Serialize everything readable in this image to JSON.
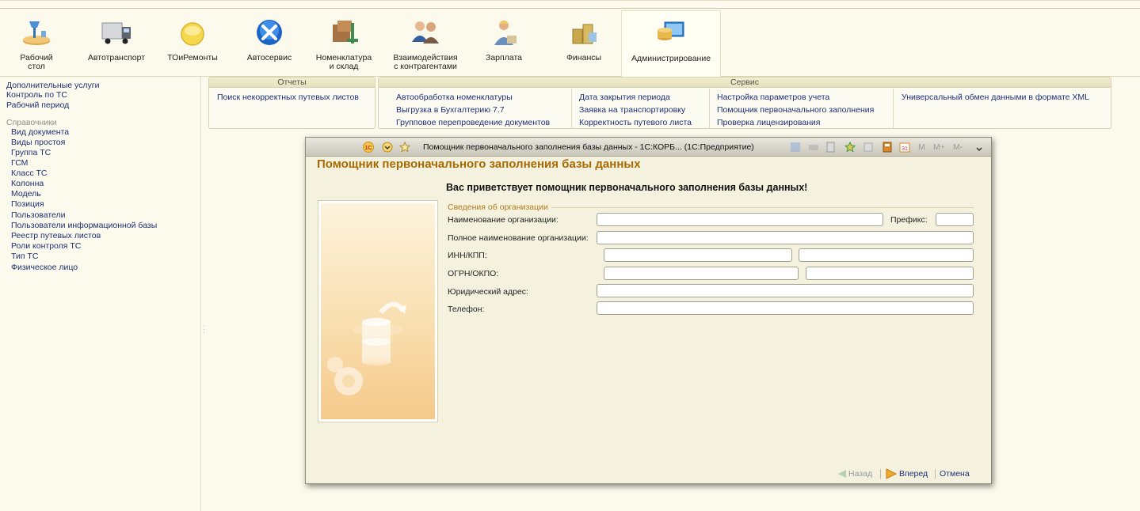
{
  "sections": [
    {
      "label": "Рабочий\nстол",
      "icon": "desktop-lamp-icon"
    },
    {
      "label": "Автотранспорт",
      "icon": "truck-icon"
    },
    {
      "label": "ТОиРемонты",
      "icon": "yellow-circle-icon"
    },
    {
      "label": "Автосервис",
      "icon": "wrench-screwdriver-icon"
    },
    {
      "label": "Номенклатура\nи склад",
      "icon": "warehouse-boxes-icon"
    },
    {
      "label": "Взаимодействия\nс контрагентами",
      "icon": "people-icon"
    },
    {
      "label": "Зарплата",
      "icon": "worker-icon"
    },
    {
      "label": "Финансы",
      "icon": "coins-icon"
    },
    {
      "label": "Администрирование",
      "icon": "computer-admin-icon"
    }
  ],
  "left_nav": {
    "links": [
      "Дополнительные услуги",
      "Контроль по ТС",
      "Рабочий период"
    ],
    "catalogs_title": "Справочники",
    "catalogs": [
      "Вид документа",
      "Виды простоя",
      "Группа ТС",
      "ГСМ",
      "Класс ТС",
      "Колонна",
      "Модель",
      "Позиция",
      "Пользователи",
      "Пользователи информационной базы",
      "Реестр путевых листов",
      "Роли контроля ТС",
      "Тип ТС",
      "Физическое лицо"
    ]
  },
  "reports_panel": {
    "title": "Отчеты",
    "items": [
      "Поиск некорректных путевых листов"
    ]
  },
  "service_panel": {
    "title": "Сервис",
    "col1": [
      "Автообработка номенклатуры",
      "Выгрузка в Бухгалтерию 7.7",
      "Групповое перепроведение документов"
    ],
    "col2": [
      "Дата закрытия периода",
      "Заявка на транспортировку",
      "Корректность путевого листа"
    ],
    "col3": [
      "Настройка параметров учета",
      "Помощник первоначального заполнения",
      "Проверка лицензирования"
    ],
    "col4": [
      "Универсальный обмен данными в формате XML"
    ]
  },
  "modal": {
    "window_title": "Помощник первоначального заполнения базы данных - 1С:КОРБ...  (1С:Предприятие)",
    "toolbar_letters": [
      "M",
      "M+",
      "M-"
    ],
    "heading": "Помощник первоначального заполнения базы данных",
    "welcome": "Вас приветствует помощник первоначального заполнения базы данных!",
    "group_title": "Сведения об организации",
    "labels": {
      "org_name": "Наименование организации:",
      "prefix": "Префикс:",
      "full_name": "Полное наименование организации:",
      "inn_kpp": "ИНН/КПП:",
      "ogrn_okpo": "ОГРН/ОКПО:",
      "address": "Юридический адрес:",
      "phone": "Телефон:"
    },
    "values": {
      "org_name": "",
      "prefix": "",
      "full_name": "",
      "inn": "",
      "kpp": "",
      "ogrn": "",
      "okpo": "",
      "address": "",
      "phone": ""
    },
    "footer": {
      "back": "Назад",
      "next": "Вперед",
      "cancel": "Отмена"
    }
  }
}
